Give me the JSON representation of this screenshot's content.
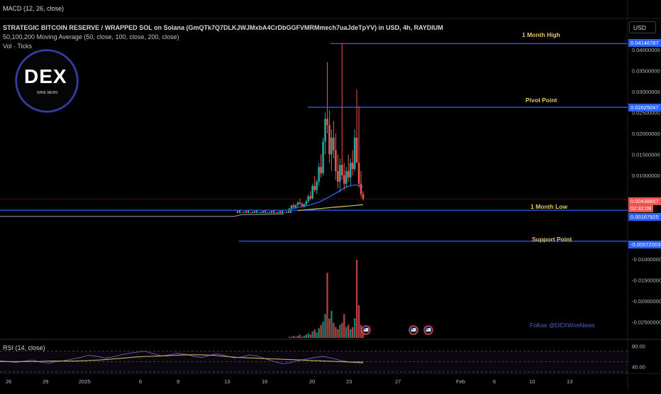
{
  "top_indicator": "MACD (12, 26, close)",
  "header": {
    "title": "STRATEGIC BITCOIN RESERVE / WRAPPED SOL on Solana (GmQTk7Q7DLKJWJMxbA4CrDbGGFVMRMmech7uaJdeTpYV) in USD, 4h, RAYDIUM",
    "moving_average": "50,100,200 Moving Average (50, close, 100, close, 200, close)",
    "volume": "Vol · Ticks"
  },
  "currency_button": "USD",
  "logo": {
    "text": "DEX",
    "subtext": "WIRE NEWS"
  },
  "follow_text": "Follow @DEXWireNews",
  "colors": {
    "up": "#26a69a",
    "down": "#ef5350",
    "level": "#2962ff",
    "level_label": "#e8c66a",
    "ma_blue": "#2962ff",
    "ma_yellow": "#c9b458",
    "rsi": "#7e57c2"
  },
  "chart_data": [
    {
      "type": "line",
      "title": "STRATEGIC BITCOIN RESERVE / WRAPPED SOL on Solana (GmQTk7Q7DLKJWJMxbA4CrDbGGFVMRMmech7uaJdeTpYV) in USD, 4h, RAYDIUM",
      "subtype": "candlestick",
      "price_axis_ticks": [
        "0.04000000",
        "0.03500000",
        "0.03000000",
        "0.02500000",
        "0.02000000",
        "0.01500000",
        "0.01000000",
        "-0.01000000",
        "-0.01500000",
        "-0.02000000",
        "-0.02500000"
      ],
      "ylim": [
        -0.027,
        0.045
      ],
      "x_tick_labels": [
        "26",
        "29",
        "2025",
        "6",
        "9",
        "13",
        "16",
        "20",
        "23",
        "27",
        "Feb",
        "6",
        "10",
        "13"
      ],
      "levels": [
        {
          "name": "1 Month High",
          "value": 0.04146787,
          "label": "0.04146787"
        },
        {
          "name": "Pivot Point",
          "value": 0.02625047,
          "label": "0.02625047"
        },
        {
          "name": "1 Month Low",
          "value": 0.00167925,
          "label": "0.00167925"
        },
        {
          "name": "Support Point",
          "value": -0.00572003,
          "label": "-0.00572003"
        }
      ],
      "current_price": {
        "label": "0.00438657",
        "countdown": "02:32:09"
      },
      "candles": [
        {
          "o": 0.0018,
          "h": 0.0022,
          "l": 0.0016,
          "c": 0.0021
        },
        {
          "o": 0.0021,
          "h": 0.003,
          "l": 0.0019,
          "c": 0.0028
        },
        {
          "o": 0.0028,
          "h": 0.0034,
          "l": 0.0022,
          "c": 0.0024
        },
        {
          "o": 0.0024,
          "h": 0.0031,
          "l": 0.002,
          "c": 0.0029
        },
        {
          "o": 0.0029,
          "h": 0.0038,
          "l": 0.0025,
          "c": 0.0035
        },
        {
          "o": 0.0035,
          "h": 0.0044,
          "l": 0.003,
          "c": 0.0032
        },
        {
          "o": 0.0032,
          "h": 0.0036,
          "l": 0.0024,
          "c": 0.0027
        },
        {
          "o": 0.0027,
          "h": 0.0034,
          "l": 0.0022,
          "c": 0.0031
        },
        {
          "o": 0.0031,
          "h": 0.0042,
          "l": 0.0026,
          "c": 0.0038
        },
        {
          "o": 0.0038,
          "h": 0.0055,
          "l": 0.0034,
          "c": 0.005
        },
        {
          "o": 0.005,
          "h": 0.0062,
          "l": 0.004,
          "c": 0.0045
        },
        {
          "o": 0.0045,
          "h": 0.008,
          "l": 0.0042,
          "c": 0.0075
        },
        {
          "o": 0.0075,
          "h": 0.0098,
          "l": 0.006,
          "c": 0.0065
        },
        {
          "o": 0.0065,
          "h": 0.009,
          "l": 0.0055,
          "c": 0.0085
        },
        {
          "o": 0.0085,
          "h": 0.013,
          "l": 0.0075,
          "c": 0.012
        },
        {
          "o": 0.012,
          "h": 0.015,
          "l": 0.0095,
          "c": 0.0105
        },
        {
          "o": 0.0105,
          "h": 0.019,
          "l": 0.01,
          "c": 0.018
        },
        {
          "o": 0.018,
          "h": 0.025,
          "l": 0.015,
          "c": 0.0235
        },
        {
          "o": 0.0235,
          "h": 0.037,
          "l": 0.02,
          "c": 0.022
        },
        {
          "o": 0.022,
          "h": 0.0255,
          "l": 0.013,
          "c": 0.015
        },
        {
          "o": 0.015,
          "h": 0.021,
          "l": 0.011,
          "c": 0.019
        },
        {
          "o": 0.019,
          "h": 0.023,
          "l": 0.014,
          "c": 0.016
        },
        {
          "o": 0.016,
          "h": 0.02,
          "l": 0.009,
          "c": 0.011
        },
        {
          "o": 0.011,
          "h": 0.015,
          "l": 0.007,
          "c": 0.0085
        },
        {
          "o": 0.0085,
          "h": 0.014,
          "l": 0.006,
          "c": 0.0125
        },
        {
          "o": 0.0125,
          "h": 0.0415,
          "l": 0.009,
          "c": 0.01
        },
        {
          "o": 0.01,
          "h": 0.013,
          "l": 0.0065,
          "c": 0.008
        },
        {
          "o": 0.008,
          "h": 0.012,
          "l": 0.007,
          "c": 0.011
        },
        {
          "o": 0.011,
          "h": 0.015,
          "l": 0.0085,
          "c": 0.0095
        },
        {
          "o": 0.0095,
          "h": 0.014,
          "l": 0.0075,
          "c": 0.013
        },
        {
          "o": 0.013,
          "h": 0.016,
          "l": 0.01,
          "c": 0.0115
        },
        {
          "o": 0.0115,
          "h": 0.021,
          "l": 0.011,
          "c": 0.019
        },
        {
          "o": 0.019,
          "h": 0.0305,
          "l": 0.015,
          "c": 0.013
        },
        {
          "o": 0.013,
          "h": 0.0265,
          "l": 0.007,
          "c": 0.008
        },
        {
          "o": 0.008,
          "h": 0.011,
          "l": 0.0048,
          "c": 0.0055
        },
        {
          "o": 0.0055,
          "h": 0.0062,
          "l": 0.004,
          "c": 0.0044
        }
      ],
      "ma_blue": [
        0.002,
        0.0022,
        0.0024,
        0.0026,
        0.0028,
        0.0031,
        0.0034,
        0.0038,
        0.0043,
        0.0048,
        0.0054,
        0.006,
        0.0066,
        0.0072,
        0.0075,
        0.0077,
        0.0076,
        0.0072
      ],
      "ma_yellow": [
        0.0016,
        0.0017,
        0.0018,
        0.0019,
        0.002,
        0.0021,
        0.0022,
        0.0023,
        0.0024,
        0.0025,
        0.0026,
        0.0027,
        0.0028,
        0.0029,
        0.003
      ],
      "volume": [
        1,
        1,
        2,
        1,
        2,
        3,
        1,
        2,
        3,
        4,
        3,
        6,
        8,
        5,
        9,
        12,
        15,
        22,
        60,
        18,
        25,
        14,
        10,
        8,
        12,
        14,
        22,
        10,
        12,
        8,
        10,
        18,
        72,
        30,
        12,
        6
      ]
    },
    {
      "type": "line",
      "title": "RSI (14, close)",
      "ylim": [
        30,
        90
      ],
      "y_tick_labels": [
        "80.00",
        "40.00"
      ],
      "bands": [
        70,
        50,
        30
      ],
      "rsi": [
        52,
        50,
        48,
        51,
        53,
        49,
        47,
        50,
        52,
        55,
        58,
        62,
        60,
        57,
        59,
        63,
        66,
        68,
        70,
        65,
        61,
        63,
        66,
        64,
        60,
        58,
        62,
        65,
        61,
        57,
        59,
        63,
        60,
        55,
        50,
        46,
        48,
        52,
        55,
        58,
        60,
        57,
        53,
        50,
        48,
        47
      ],
      "rsi_ma": [
        50,
        50,
        50,
        50,
        51,
        51,
        51,
        52,
        53,
        55,
        57,
        59,
        60,
        61,
        62,
        63,
        63,
        62,
        60,
        58,
        57,
        56,
        55,
        54,
        53,
        52,
        51,
        50,
        49,
        49
      ]
    }
  ]
}
